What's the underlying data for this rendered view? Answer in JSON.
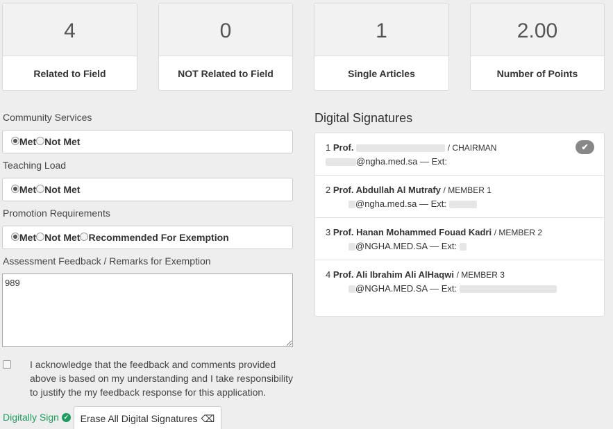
{
  "stats": [
    {
      "value": "4",
      "label": "Related to Field"
    },
    {
      "value": "0",
      "label": "NOT Related to Field"
    },
    {
      "value": "1",
      "label": "Single Articles"
    },
    {
      "value": "2.00",
      "label": "Number of Points"
    }
  ],
  "form": {
    "community": {
      "label": "Community Services",
      "options": [
        "Met",
        "Not Met"
      ],
      "selected": "Met"
    },
    "teaching": {
      "label": "Teaching Load",
      "options": [
        "Met",
        "Not Met"
      ],
      "selected": "Met"
    },
    "promotion": {
      "label": "Promotion Requirements",
      "options": [
        "Met",
        "Not Met",
        "Recommended For Exemption"
      ],
      "selected": "Met"
    },
    "feedback": {
      "label": "Assessment Feedback / Remarks for Exemption",
      "value": "989"
    },
    "acknowledge": {
      "text": "I acknowledge that the feedback and comments provided above is based on my understanding and I take responsibility to justify the my feedback response for this application.",
      "checked": false
    },
    "digitally_sign": "Digitally Sign",
    "erase_button": "Erase All Digital Signatures"
  },
  "signatures": {
    "heading": "Digital Signatures",
    "items": [
      {
        "index": "1",
        "name": "Prof.",
        "role": "/ CHAIRMAN",
        "email": "@ngha.med.sa — Ext:",
        "signed": true
      },
      {
        "index": "2",
        "name": "Prof. Abdullah Al Mutrafy",
        "role": "/ MEMBER 1",
        "email": "@ngha.med.sa — Ext:",
        "signed": false
      },
      {
        "index": "3",
        "name": "Prof. Hanan Mohammed Fouad Kadri",
        "role": "/ MEMBER 2",
        "email": "@NGHA.MED.SA — Ext:",
        "signed": false
      },
      {
        "index": "4",
        "name": "Prof. Ali Ibrahim Ali AlHaqwi",
        "role": "/ MEMBER 3",
        "email": "@NGHA.MED.SA — Ext:",
        "signed": false
      }
    ]
  },
  "colors": {
    "accent_green": "#1e9b5e",
    "badge_gray": "#888888"
  }
}
